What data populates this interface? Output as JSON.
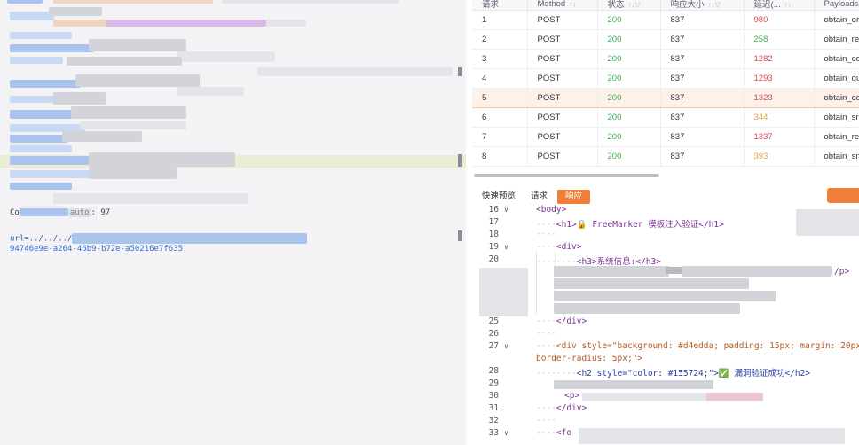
{
  "left_panel": {
    "line_content_label": "Co",
    "line_content_tag": "auto",
    "line_content_value": ": 97",
    "url_prefix": "url=../../../",
    "uuid": "94746e9e-a264-46b9-b72e-a50216e7f635"
  },
  "table": {
    "columns": [
      {
        "label": "请求"
      },
      {
        "label": "Method"
      },
      {
        "label": "状态"
      },
      {
        "label": "响应大小"
      },
      {
        "label": "延迟(..."
      },
      {
        "label": "Payloads"
      }
    ],
    "rows": [
      {
        "id": "1",
        "method": "POST",
        "status": "200",
        "size": "837",
        "latency": "980",
        "latency_color": "red",
        "payload": "obtain_or"
      },
      {
        "id": "2",
        "method": "POST",
        "status": "200",
        "size": "837",
        "latency": "258",
        "latency_color": "green",
        "payload": "obtain_re"
      },
      {
        "id": "3",
        "method": "POST",
        "status": "200",
        "size": "837",
        "latency": "1282",
        "latency_color": "red",
        "payload": "obtain_co"
      },
      {
        "id": "4",
        "method": "POST",
        "status": "200",
        "size": "837",
        "latency": "1293",
        "latency_color": "red",
        "payload": "obtain_qu"
      },
      {
        "id": "5",
        "method": "POST",
        "status": "200",
        "size": "837",
        "latency": "1323",
        "latency_color": "red",
        "payload": "obtain_co",
        "selected": true
      },
      {
        "id": "6",
        "method": "POST",
        "status": "200",
        "size": "837",
        "latency": "344",
        "latency_color": "orange",
        "payload": "obtain_sr"
      },
      {
        "id": "7",
        "method": "POST",
        "status": "200",
        "size": "837",
        "latency": "1337",
        "latency_color": "red",
        "payload": "obtain_re"
      },
      {
        "id": "8",
        "method": "POST",
        "status": "200",
        "size": "837",
        "latency": "393",
        "latency_color": "orange",
        "payload": "obtain_sn"
      }
    ]
  },
  "tabs": [
    {
      "label": "快速预览"
    },
    {
      "label": "请求"
    },
    {
      "label": "响应",
      "active": true
    }
  ],
  "code_lines": [
    {
      "num": "16",
      "fold": true,
      "text": "<body>"
    },
    {
      "num": "17",
      "fold": false,
      "text": "<h1>🔒 FreeMarker 模板注入验证</h1>"
    },
    {
      "num": "18",
      "fold": false,
      "text": ""
    },
    {
      "num": "19",
      "fold": true,
      "text": "<div>"
    },
    {
      "num": "20",
      "fold": false,
      "text": "<h3>系统信息:</h3>"
    },
    {
      "num": "25",
      "fold": false,
      "text": "</div>"
    },
    {
      "num": "26",
      "fold": false,
      "text": ""
    },
    {
      "num": "27",
      "fold": true,
      "text": "<div style=\"background: #d4edda; padding: 15px; margin: 20px 0;"
    },
    {
      "num": "",
      "fold": false,
      "text": "border-radius: 5px;\">"
    },
    {
      "num": "28",
      "fold": false,
      "text": "<h2 style=\"color: #155724;\">✅ 漏洞验证成功</h2>"
    },
    {
      "num": "29",
      "fold": false,
      "text": ""
    },
    {
      "num": "30",
      "fold": false,
      "text": ""
    },
    {
      "num": "31",
      "fold": false,
      "text": "</div>"
    },
    {
      "num": "32",
      "fold": false,
      "text": ""
    },
    {
      "num": "33",
      "fold": true,
      "text": "<fo"
    }
  ],
  "code_fragments": {
    "p_close": "/p>",
    "line30_text": "<p>"
  },
  "colors": {
    "accent": "#f07d38",
    "status_ok": "#3cb04f",
    "latency_red": "#e0474c",
    "latency_orange": "#e8a33a",
    "selected_row_bg": "#fdf2ea"
  }
}
